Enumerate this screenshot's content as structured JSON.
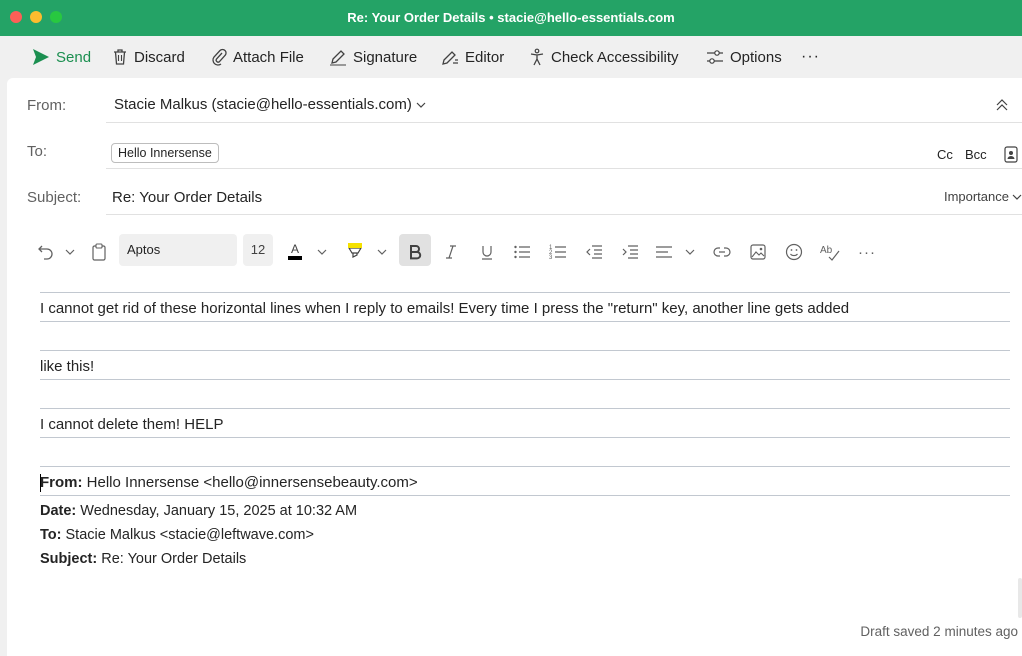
{
  "window": {
    "title": "Re: Your Order Details • stacie@hello-essentials.com",
    "controls": [
      "close",
      "minimize",
      "zoom"
    ]
  },
  "toolbar": {
    "send": {
      "label": "Send",
      "icon": "send-icon"
    },
    "discard": {
      "label": "Discard",
      "icon": "trash-icon"
    },
    "attach": {
      "label": "Attach File",
      "icon": "paperclip-icon"
    },
    "signature": {
      "label": "Signature",
      "icon": "pen-icon"
    },
    "editor": {
      "label": "Editor",
      "icon": "editor-pen-icon"
    },
    "accessibility": {
      "label": "Check Accessibility",
      "icon": "accessibility-icon"
    },
    "options": {
      "label": "Options",
      "icon": "sliders-icon"
    },
    "more": "···"
  },
  "header": {
    "from_label": "From:",
    "from_value": "Stacie Malkus (stacie@hello-essentials.com)",
    "to_label": "To:",
    "to_recipient": "Hello Innersense",
    "cc_label": "Cc",
    "bcc_label": "Bcc",
    "subject_label": "Subject:",
    "subject_value": "Re: Your Order Details",
    "importance_label": "Importance"
  },
  "format": {
    "font_name": "Aptos",
    "font_size": "12",
    "more": "···",
    "font_color": "#000000",
    "highlight_color": "#f5e100"
  },
  "body": {
    "line1": "I cannot get rid of these horizontal lines when I reply to emails! Every time I press the \"return\" key, another line gets added",
    "line2": "like this!",
    "line3": "I cannot delete them! HELP",
    "quoted": {
      "from_label": "From:",
      "from_value": "Hello Innersense <hello@innersensebeauty.com>",
      "date_label": "Date:",
      "date_value": "Wednesday, January 15, 2025 at 10:32 AM",
      "to_label": "To:",
      "to_value": "Stacie Malkus <stacie@leftwave.com>",
      "subject_label": "Subject:",
      "subject_value": "Re: Your Order Details"
    }
  },
  "status": {
    "draft": "Draft saved 2 minutes ago"
  },
  "colors": {
    "titlebar": "#24a366",
    "send_accent": "#1b8f50",
    "rule": "#c2c8d0"
  }
}
